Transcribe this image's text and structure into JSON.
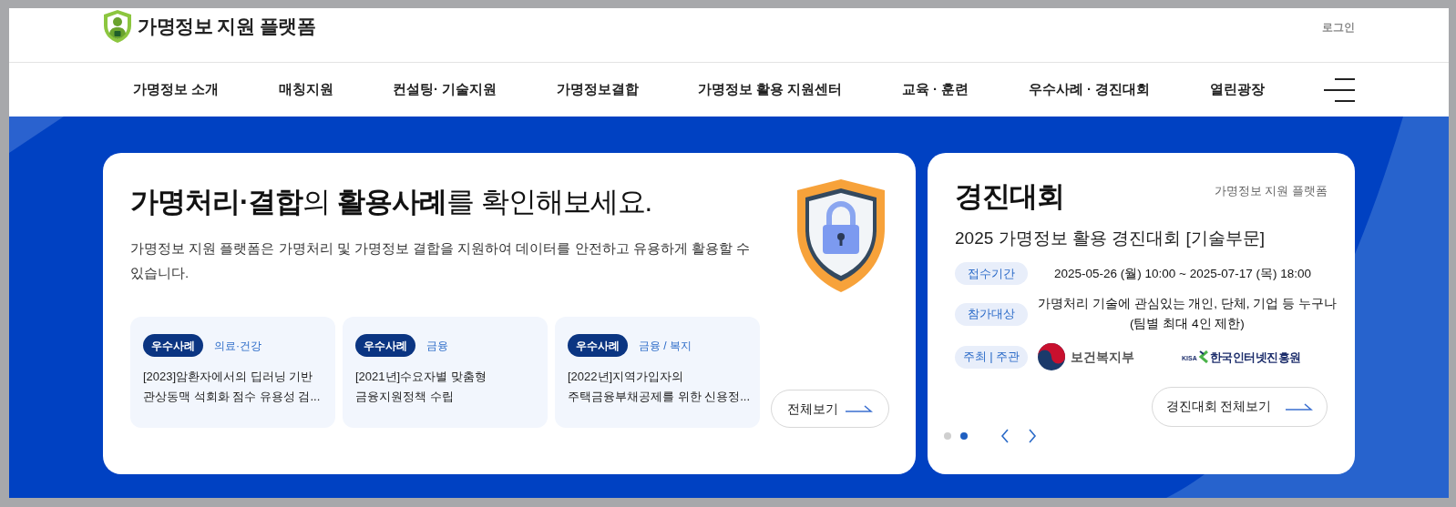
{
  "header": {
    "logo_text": "가명정보 지원 플랫폼",
    "login": "로그인"
  },
  "nav": {
    "items": [
      "가명정보 소개",
      "매칭지원",
      "컨설팅· 기술지원",
      "가명정보결합",
      "가명정보 활용 지원센터",
      "교육 · 훈련",
      "우수사례 · 경진대회",
      "열린광장"
    ]
  },
  "hero_card": {
    "title": "**가명처리·결합**의 **활용사례**를 확인해보세요.",
    "description": "가명정보 지원 플랫폼은 가명처리 및 가명정보 결합을 지원하여 데이터를 안전하고 유용하게 활용할 수 있습니다.",
    "cases": [
      {
        "badge": "우수사례",
        "category": "의료·건강",
        "title_lines": [
          "[2023]암환자에서의 딥러닝 기반",
          "관상동맥 석회화 점수 유용성 검..."
        ]
      },
      {
        "badge": "우수사례",
        "category": "금융",
        "title_lines": [
          "[2021년]수요자별 맞춤형",
          "금융지원정책 수립"
        ]
      },
      {
        "badge": "우수사례",
        "category": "금융 / 복지",
        "title_lines": [
          "[2022년]지역가입자의",
          "주택금융부채공제를 위한 신용정..."
        ]
      }
    ],
    "view_all": "전체보기"
  },
  "contest_card": {
    "title": "경진대회",
    "source": "가명정보 지원 플랫폼",
    "subtitle": "2025 가명정보 활용 경진대회 [기술부문]",
    "details": [
      {
        "kind": "text",
        "label": "접수기간",
        "lines": [
          "2025-05-26 (월) 10:00 ~ 2025-07-17 (목) 18:00"
        ]
      },
      {
        "kind": "text",
        "label": "참가대상",
        "lines": [
          "가명처리 기술에 관심있는 개인, 단체, 기업 등 누구나",
          "(팀별 최대 4인 제한)"
        ]
      },
      {
        "kind": "logos",
        "label": "주최 | 주관",
        "logos": [
          {
            "kind": "mohw",
            "name": "보건복지부"
          },
          {
            "kind": "kisa",
            "prefix": "KISA",
            "name": "한국인터넷진흥원"
          }
        ]
      }
    ],
    "view_all": "경진대회 전체보기",
    "pages": [
      {
        "selected": false
      },
      {
        "selected": true
      }
    ]
  }
}
